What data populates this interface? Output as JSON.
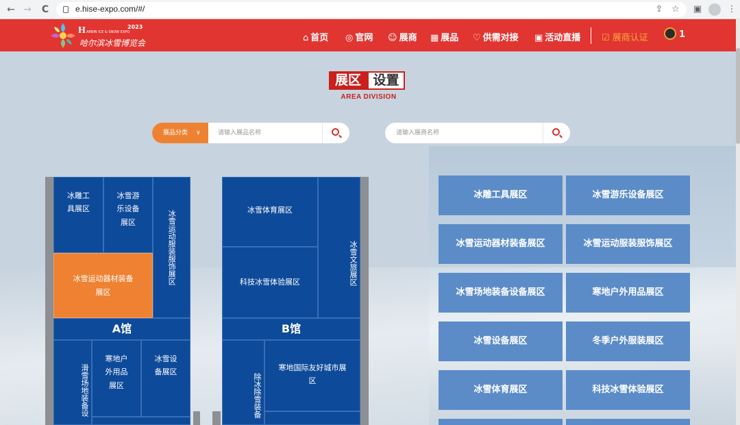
{
  "browser": {
    "url": "e.hise-expo.com/#/",
    "back_icon": "←",
    "forward_icon": "→",
    "reload_icon": "C"
  },
  "header": {
    "logo_year": "2023",
    "logo_en": "ARBIN ICE & SNOW EXPO",
    "logo_cn": "哈尔滨冰雪博览会",
    "nav": [
      {
        "icon": "⌂",
        "label": "首页"
      },
      {
        "icon": "◎",
        "label": "官网"
      },
      {
        "icon": "☺",
        "label": "展商"
      },
      {
        "icon": "▦",
        "label": "展品"
      },
      {
        "icon": "♡",
        "label": "供需对接"
      },
      {
        "icon": "▣",
        "label": "活动直播"
      }
    ],
    "cert_label": "展商认证",
    "user_count": "1"
  },
  "title": {
    "part1": "展区",
    "part2": "设置",
    "subtitle": "AREA DIVISION"
  },
  "search": {
    "category_label": "展品分类",
    "product_placeholder": "请输入展品名称",
    "exhibitor_placeholder": "请输入展商名称"
  },
  "hall_a": {
    "label": "A馆",
    "zones": [
      "冰雕工具展区",
      "冰雪游乐设备展区",
      "冰雪运动服装服饰展区",
      "冰雪运动器材装备展区",
      "滑雪场地装备设",
      "寒地户外用品展区",
      "冰雪设备展区"
    ]
  },
  "hall_b": {
    "label": "B馆",
    "zones": [
      "冰雪体育展区",
      "冰雪文旅展区",
      "科技冰雪体验展区",
      "除冰除雪装备",
      "寒地国际友好城市展区"
    ]
  },
  "zone_buttons": [
    "冰雕工具展区",
    "冰雪游乐设备展区",
    "冰雪运动器材装备展区",
    "冰雪运动服装服饰展区",
    "冰雪场地装备设备展区",
    "寒地户外用品展区",
    "冰雪设备展区",
    "冬季户外服装展区",
    "冰雪体育展区",
    "科技冰雪体验展区"
  ]
}
